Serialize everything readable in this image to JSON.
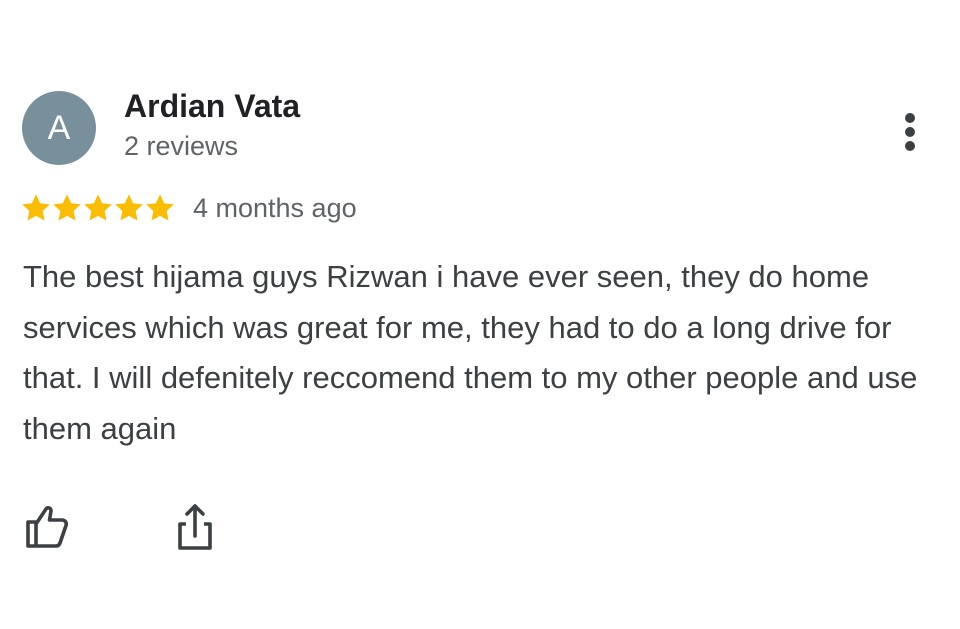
{
  "review": {
    "author": {
      "avatar_letter": "A",
      "avatar_color": "#78909c",
      "name": "Ardian Vata",
      "review_count": "2 reviews"
    },
    "rating": {
      "stars": 5,
      "max_stars": 5,
      "star_color": "#fbbc04"
    },
    "date": "4 months ago",
    "text": "The best hijama guys Rizwan i have ever seen, they do home services which was great for me, they had to do a long drive for that. I will defenitely reccomend them to my other people and use them again",
    "actions": {
      "more_icon": "more-vert-icon",
      "like_icon": "thumbs-up-icon",
      "share_icon": "share-icon"
    }
  }
}
